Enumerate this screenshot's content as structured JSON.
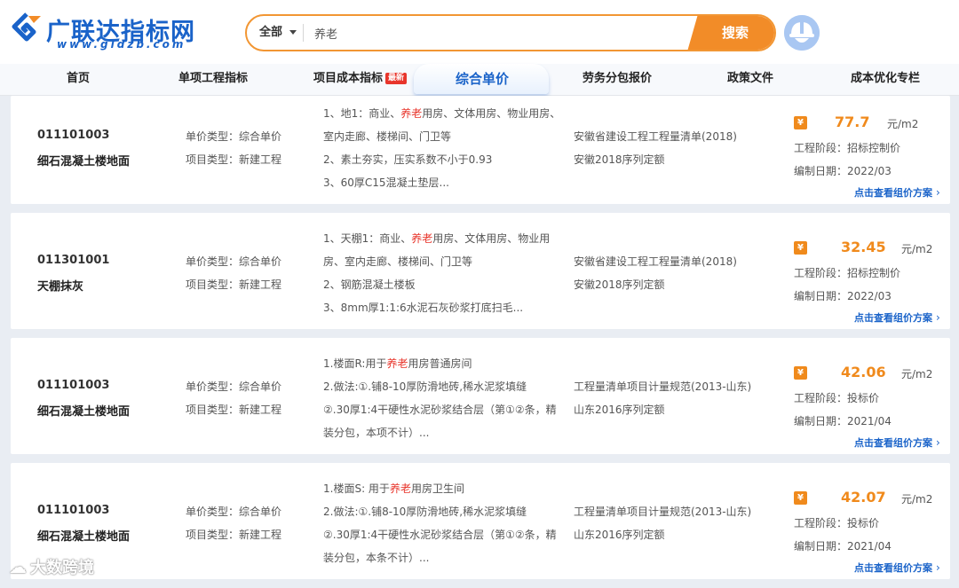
{
  "header": {
    "logo_title": "广联达指标网",
    "logo_sub": "www.gldzb.com",
    "search_scope": "全部",
    "search_value": "养老",
    "search_button": "搜索"
  },
  "nav": {
    "items": [
      "首页",
      "单项工程指标",
      "项目成本指标",
      "综合单价",
      "劳务分包报价",
      "政策文件",
      "成本优化专栏"
    ],
    "badge": "最新",
    "active": "综合单价"
  },
  "results": [
    {
      "code": "011101003",
      "name": "细石混凝土楼地面",
      "price_type": "单价类型：综合单价",
      "project_type": "项目类型：新建工程",
      "features": [
        [
          "1、地1：商业、",
          "养老",
          "用房、文体用房、物业用房、"
        ],
        [
          "室内走廊、楼梯间、门卫等"
        ],
        [
          "2、素土夯实，压实系数不小于0.93"
        ],
        [
          "3、60厚C15混凝土垫层..."
        ]
      ],
      "standard": "安徽省建设工程工程量清单(2018)",
      "quota": "安徽2018序列定额",
      "price": "77.7",
      "unit": "元/m2",
      "stage": "工程阶段：招标控制价",
      "date": "编制日期：2022/03",
      "link": "点击查看组价方案"
    },
    {
      "code": "011301001",
      "name": "天棚抹灰",
      "price_type": "单价类型：综合单价",
      "project_type": "项目类型：新建工程",
      "features": [
        [
          "1、天棚1：商业、",
          "养老",
          "用房、文体用房、物业用"
        ],
        [
          "房、室内走廊、楼梯间、门卫等"
        ],
        [
          "2、钢筋混凝土楼板"
        ],
        [
          "3、8mm厚1:1:6水泥石灰砂浆打底扫毛..."
        ]
      ],
      "standard": "安徽省建设工程工程量清单(2018)",
      "quota": "安徽2018序列定额",
      "price": "32.45",
      "unit": "元/m2",
      "stage": "工程阶段：招标控制价",
      "date": "编制日期：2022/03",
      "link": "点击查看组价方案"
    },
    {
      "code": "011101003",
      "name": "细石混凝土楼地面",
      "price_type": "单价类型：综合单价",
      "project_type": "项目类型：新建工程",
      "features": [
        [
          "1.楼面R:用于",
          "养老",
          "用房普通房间"
        ],
        [
          "2.做法:①.铺8-10厚防滑地砖,稀水泥浆填缝"
        ],
        [
          "②.30厚1:4干硬性水泥砂浆结合层（第①②条，精"
        ],
        [
          "装分包，本项不计）..."
        ]
      ],
      "standard": "工程量清单项目计量规范(2013-山东)",
      "quota": "山东2016序列定额",
      "price": "42.06",
      "unit": "元/m2",
      "stage": "工程阶段：投标价",
      "date": "编制日期：2021/04",
      "link": "点击查看组价方案"
    },
    {
      "code": "011101003",
      "name": "细石混凝土楼地面",
      "price_type": "单价类型：综合单价",
      "project_type": "项目类型：新建工程",
      "features": [
        [
          "1.楼面S: 用于",
          "养老",
          "用房卫生间"
        ],
        [
          "2.做法:①.铺8-10厚防滑地砖,稀水泥浆填缝"
        ],
        [
          "②.30厚1:4干硬性水泥砂浆结合层（第①②条，精"
        ],
        [
          "装分包，本条不计）..."
        ]
      ],
      "standard": "工程量清单项目计量规范(2013-山东)",
      "quota": "山东2016序列定额",
      "price": "42.07",
      "unit": "元/m2",
      "stage": "工程阶段：投标价",
      "date": "编制日期：2021/04",
      "link": "点击查看组价方案"
    }
  ],
  "price_icon_glyph": "¥",
  "link_chevron": "›",
  "watermark": "大数跨境",
  "colors": {
    "brand_blue": "#1a63c9",
    "accent_orange": "#f28c28",
    "highlight_red": "#e8352b"
  }
}
